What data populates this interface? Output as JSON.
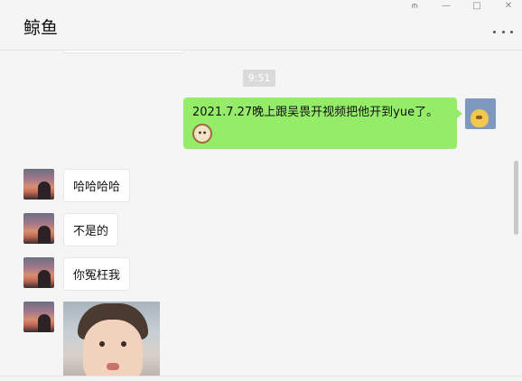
{
  "window": {
    "controls": {
      "pin": "⫙",
      "minimize": "—",
      "maximize": "□",
      "close": "✕"
    }
  },
  "header": {
    "title": "鲸鱼",
    "more_icon": "more-dots-icon"
  },
  "messages": {
    "timestamp": "9:51",
    "outgoing": {
      "text": "2021.7.27晚上跟吴畏开视频把他开到yue了。",
      "emoji": "dog-face-emoji"
    },
    "incoming": [
      {
        "text": "哈哈哈哈"
      },
      {
        "text": "不是的"
      },
      {
        "text": "你冤枉我"
      }
    ],
    "incoming_image": "photo-of-toddler"
  },
  "colors": {
    "outgoing_bubble": "#95ec69",
    "incoming_bubble": "#ffffff",
    "background": "#f5f5f5"
  }
}
